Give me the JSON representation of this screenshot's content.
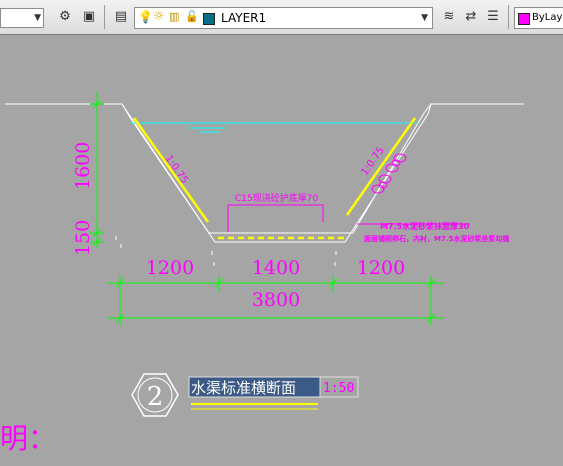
{
  "toolbar": {
    "left_combo_value": "",
    "layer_name": "LAYER1",
    "color_value": "ByLayer",
    "layer_swatch_color": "#0a6f84",
    "bylayer_swatch_color": "#ff00ff",
    "icons": [
      "gear-icon",
      "layer-state-icon",
      "layer-properties-icon",
      "lightbulb-icon",
      "sun-icon",
      "freeze-icon",
      "lock-icon",
      "layer-match-icon",
      "layer-previous-icon",
      "layer-iso-icon"
    ]
  },
  "drawing": {
    "slope_left": "1:0.75",
    "slope_right": "1:0.75",
    "bottom_note": "C15现浇砼护底厚70",
    "right_note_1": "M7.5水泥砂浆抹面厚30",
    "right_note_2": "面层铺砌卵石，内衬，M7.5水泥砂浆坐浆勾缝",
    "vert_dim_top": "1600",
    "vert_dim_bottom": "150",
    "dim_left": "1200",
    "dim_mid": "1400",
    "dim_right": "1200",
    "dim_total": "3800",
    "section_number": "2",
    "section_title": "水渠标准横断面",
    "section_scale": "1:50",
    "corner_text": "明："
  },
  "colors": {
    "background": "#a5a5a5",
    "magenta": "#ff00ff",
    "green": "#00ff00",
    "yellow": "#ffff00",
    "cyan": "#00ffff",
    "white": "#ffffff"
  }
}
